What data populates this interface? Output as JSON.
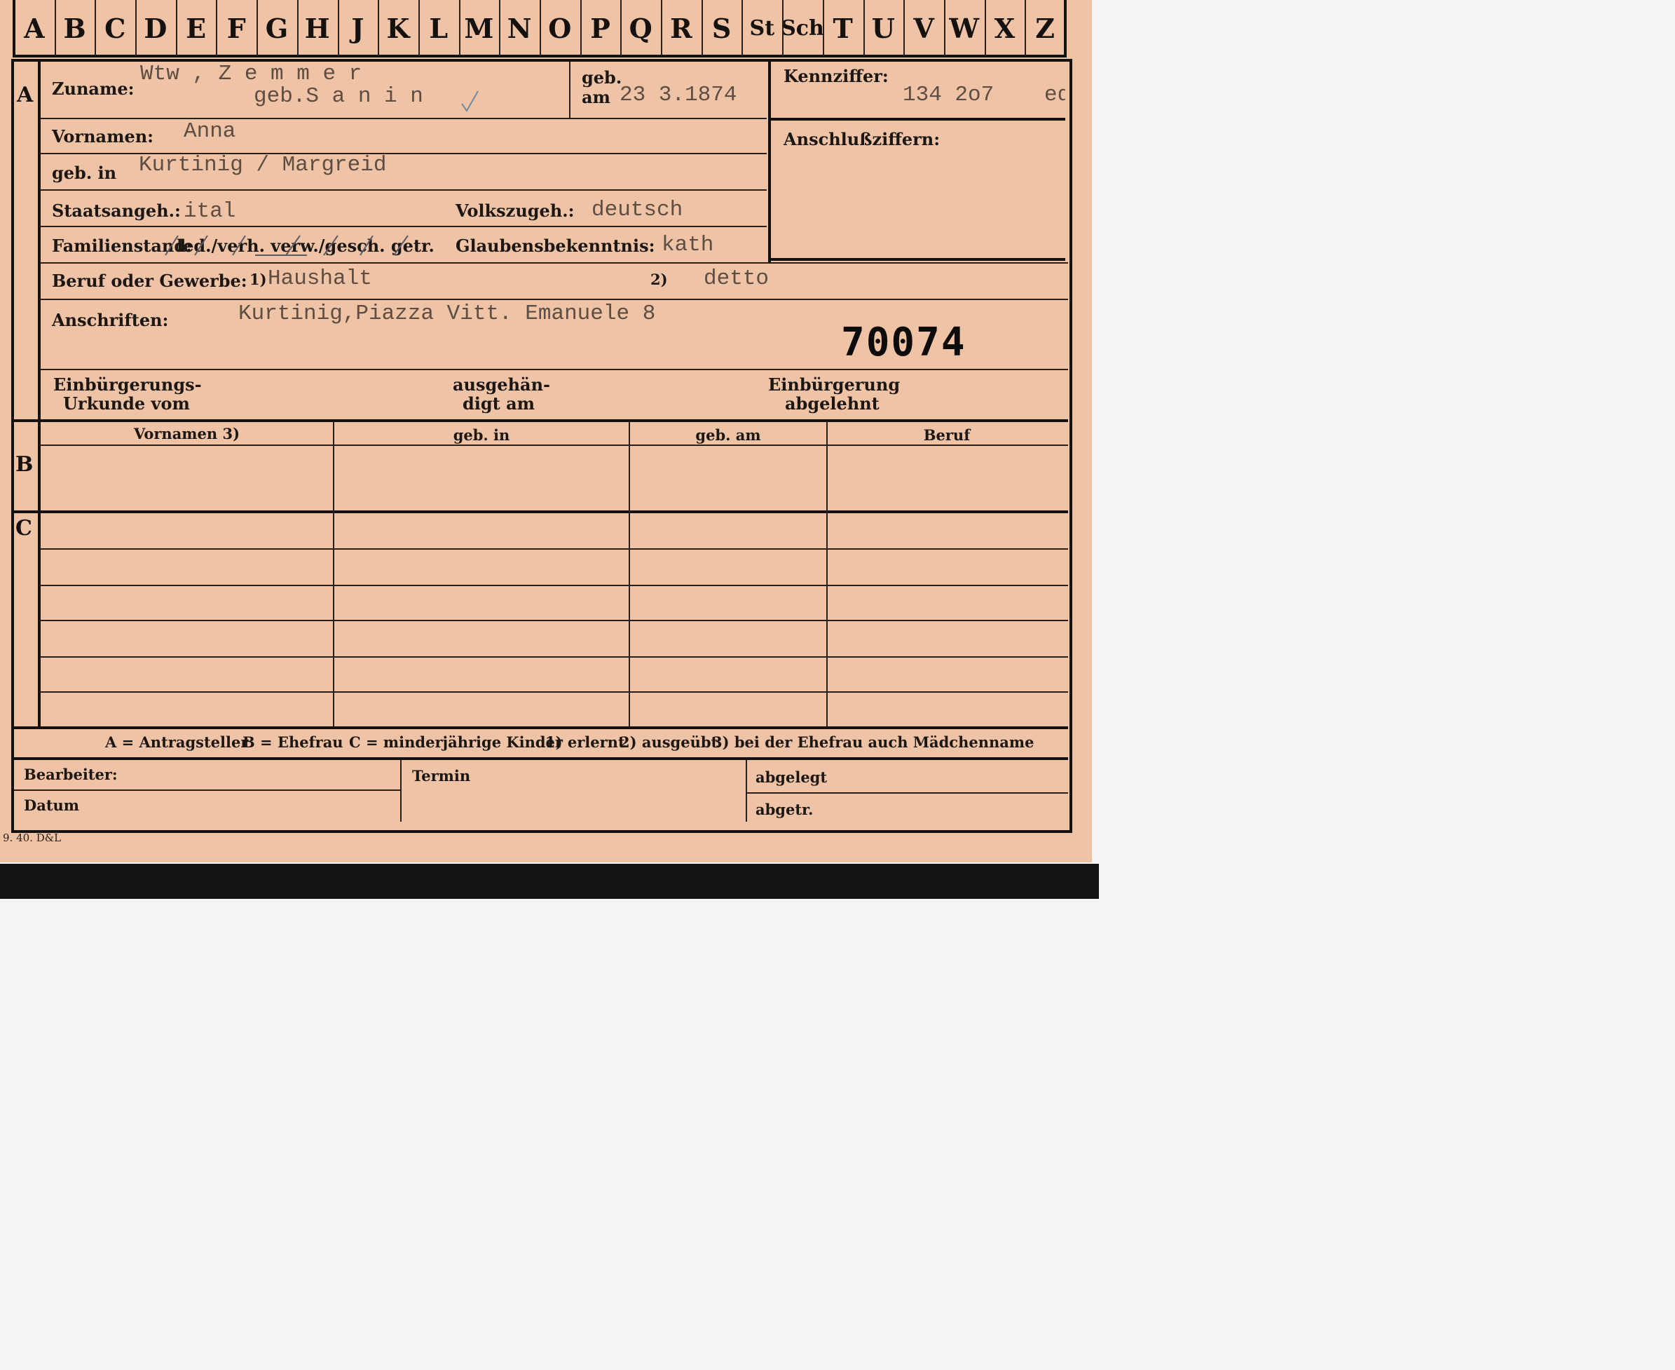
{
  "index_tabs": [
    "A",
    "B",
    "C",
    "D",
    "E",
    "F",
    "G",
    "H",
    "J",
    "K",
    "L",
    "M",
    "N",
    "O",
    "P",
    "Q",
    "R",
    "S",
    "St",
    "Sch",
    "T",
    "U",
    "V",
    "W",
    "X",
    "Z"
  ],
  "section_a": {
    "letter": "A",
    "surname_label": "Zuname:",
    "surname_line1": "Wtw , Z e m m e r",
    "surname_line2": "geb.S a n i n",
    "born_label_line1": "geb.",
    "born_label_line2": "am",
    "born_date": "23 3.1874",
    "id_label": "Kennziffer:",
    "id_value": "134 2o7",
    "id_suffix": "ed",
    "connect_label": "Anschlußziffern:",
    "firstname_label": "Vornamen:",
    "firstname_value": "Anna",
    "birthplace_label": "geb. in",
    "birthplace_value": "Kurtinig / Margreid",
    "citizenship_label": "Staatsangeh.:",
    "citizenship_value": "ital",
    "ethnicity_label": "Volkszugeh.:",
    "ethnicity_value": "deutsch",
    "family_label": "Familienstand:",
    "family_options": "led./verh. verw./gesch. getr.",
    "religion_label": "Glaubensbekenntnis:",
    "religion_value": "kath",
    "occupation_label": "Beruf oder Gewerbe:",
    "occupation_note1": "1)",
    "occupation_value1": "Haushalt",
    "occupation_note2": "2)",
    "occupation_value2": "detto",
    "address_label": "Anschriften:",
    "address_value": "Kurtinig,Piazza Vitt. Emanuele 8",
    "stamp_number": "70074",
    "naturalization_doc_line1": "Einbürgerungs-",
    "naturalization_doc_line2": "Urkunde vom",
    "handed_line1": "ausgehän-",
    "handed_line2": "digt am",
    "refused_line1": "Einbürgerung",
    "refused_line2": "abgelehnt"
  },
  "section_b": {
    "letter": "B",
    "columns": [
      "Vornamen 3)",
      "geb. in",
      "geb. am",
      "Beruf"
    ]
  },
  "section_c": {
    "letter": "C"
  },
  "legend": {
    "a": "A = Antragsteller",
    "b": "B = Ehefrau",
    "c": "C = minderjährige Kinder",
    "n1": "1) erlernt",
    "n2": "2) ausgeübt",
    "n3": "3) bei der Ehefrau auch Mädchenname"
  },
  "footer": {
    "clerk_label": "Bearbeiter:",
    "date_label": "Datum",
    "term_label": "Termin",
    "filed_label": "abgelegt",
    "separated_label": "abgetr.",
    "print_mark": "9. 40. D&L"
  }
}
